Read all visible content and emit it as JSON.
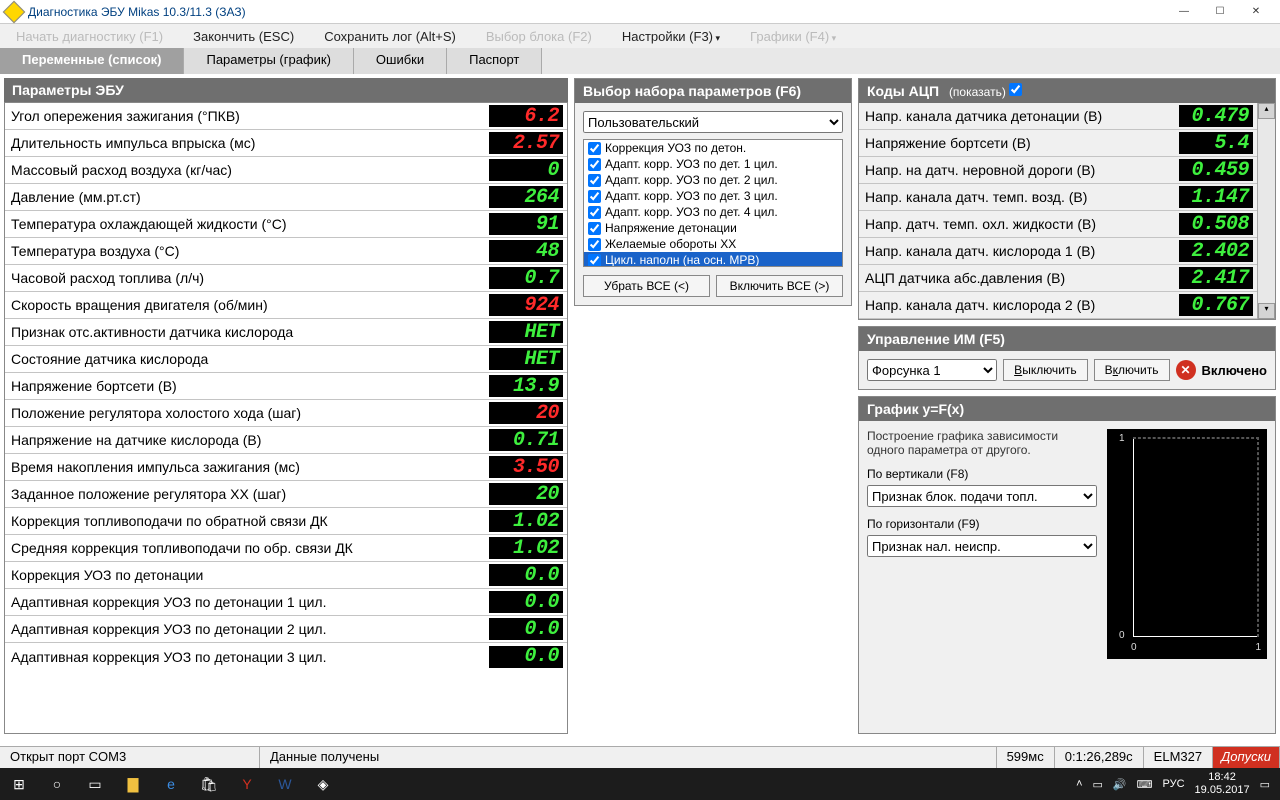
{
  "window": {
    "title": "Диагностика ЭБУ Mikas 10.3/11.3 (ЗАЗ)"
  },
  "menu": {
    "start": "Начать диагностику (F1)",
    "finish": "Закончить (ESC)",
    "savelog": "Сохранить лог (Alt+S)",
    "block": "Выбор блока (F2)",
    "settings": "Настройки (F3)",
    "graphs": "Графики (F4)"
  },
  "tabs": {
    "vars": "Переменные (список)",
    "params": "Параметры (график)",
    "errors": "Ошибки",
    "passport": "Паспорт"
  },
  "ecuParams": {
    "header": "Параметры ЭБУ",
    "rows": [
      {
        "label": "Угол опережения зажигания (°ПКВ)",
        "value": "6.2",
        "cls": "red"
      },
      {
        "label": "Длительность импульса впрыска (мс)",
        "value": "2.57",
        "cls": "red"
      },
      {
        "label": "Массовый расход воздуха (кг/час)",
        "value": "0",
        "cls": "green"
      },
      {
        "label": "Давление (мм.рт.ст)",
        "value": "264",
        "cls": "green"
      },
      {
        "label": "Температура охлаждающей жидкости (°C)",
        "value": "91",
        "cls": "green"
      },
      {
        "label": "Температура воздуха (°C)",
        "value": "48",
        "cls": "green"
      },
      {
        "label": "Часовой расход топлива (л/ч)",
        "value": "0.7",
        "cls": "green"
      },
      {
        "label": "Скорость вращения двигателя (об/мин)",
        "value": "924",
        "cls": "red"
      },
      {
        "label": "Признак отс.активности датчика кислорода",
        "value": "HET",
        "cls": "green"
      },
      {
        "label": "Состояние датчика кислорода",
        "value": "HET",
        "cls": "green"
      },
      {
        "label": "Напряжение бортсети (В)",
        "value": "13.9",
        "cls": "green"
      },
      {
        "label": "Положение регулятора холостого хода (шаг)",
        "value": "20",
        "cls": "red"
      },
      {
        "label": "Напряжение на датчике кислорода (В)",
        "value": "0.71",
        "cls": "green"
      },
      {
        "label": "Время накопления импульса зажигания (мс)",
        "value": "3.50",
        "cls": "red"
      },
      {
        "label": "Заданное положение регулятора XX (шаг)",
        "value": "20",
        "cls": "green"
      },
      {
        "label": "Коррекция топливоподачи по обратной связи ДК",
        "value": "1.02",
        "cls": "green"
      },
      {
        "label": "Средняя коррекция топливоподачи по обр. связи ДК",
        "value": "1.02",
        "cls": "green"
      },
      {
        "label": "Коррекция УОЗ по детонации",
        "value": "0.0",
        "cls": "green"
      },
      {
        "label": "Адаптивная коррекция УОЗ по детонации 1 цил.",
        "value": "0.0",
        "cls": "green"
      },
      {
        "label": "Адаптивная коррекция УОЗ по детонации 2 цил.",
        "value": "0.0",
        "cls": "green"
      },
      {
        "label": "Адаптивная коррекция УОЗ по детонации 3 цил.",
        "value": "0.0",
        "cls": "green"
      }
    ]
  },
  "paramSet": {
    "header": "Выбор набора параметров (F6)",
    "selected": "Пользовательский",
    "items": [
      "Коррекция УОЗ по детон.",
      "Адапт. корр. УОЗ по дет. 1 цил.",
      "Адапт. корр. УОЗ по дет. 2 цил.",
      "Адапт. корр. УОЗ по дет. 3 цил.",
      "Адапт. корр. УОЗ по дет. 4 цил.",
      "Напряжение детонации",
      "Желаемые обороты XX",
      "Цикл. наполн (на осн. МРВ)"
    ],
    "btn_remove": "Убрать ВСЕ (<)",
    "btn_add": "Включить ВСЕ (>)"
  },
  "adc": {
    "header": "Коды АЦП",
    "show": "(показать)",
    "rows": [
      {
        "label": "Напр. канала датчика детонации (В)",
        "value": "0.479"
      },
      {
        "label": "Напряжение бортсети (В)",
        "value": "5.4"
      },
      {
        "label": "Напр. на датч. неровной дороги (В)",
        "value": "0.459"
      },
      {
        "label": "Напр. канала датч. темп. возд. (В)",
        "value": "1.147"
      },
      {
        "label": "Напр. датч. темп. охл. жидкости (В)",
        "value": "0.508"
      },
      {
        "label": "Напр. канала датч. кислорода 1 (В)",
        "value": "2.402"
      },
      {
        "label": "АЦП датчика абс.давления (В)",
        "value": "2.417"
      },
      {
        "label": "Напр. канала датч. кислорода 2 (В)",
        "value": "0.767"
      }
    ]
  },
  "im": {
    "header": "Управление ИМ (F5)",
    "selected": "Форсунка 1",
    "btn_off": "Выключить",
    "btn_on": "Включить",
    "status": "Включено"
  },
  "graph": {
    "header": "График y=F(x)",
    "desc": "Построение графика зависимости одного параметра от другого.",
    "vlabel": "По вертикали (F8)",
    "vsel": "Признак блок. подачи топл.",
    "hlabel": "По горизонтали (F9)",
    "hsel": "Признак нал. неиспр."
  },
  "chart_data": {
    "type": "scatter",
    "x": [],
    "y": [],
    "xlabel": "",
    "ylabel": "",
    "xlim": [
      0,
      1
    ],
    "ylim": [
      0,
      1
    ],
    "xticks": [
      0,
      1
    ],
    "yticks": [
      0,
      1
    ]
  },
  "status": {
    "port": "Открыт порт COM3",
    "data": "Данные получены",
    "ping": "599мс",
    "time": "0:1:26,289с",
    "dev": "ELM327",
    "tol": "Допуски"
  },
  "tray": {
    "lang": "РУС",
    "time": "18:42",
    "date": "19.05.2017"
  }
}
